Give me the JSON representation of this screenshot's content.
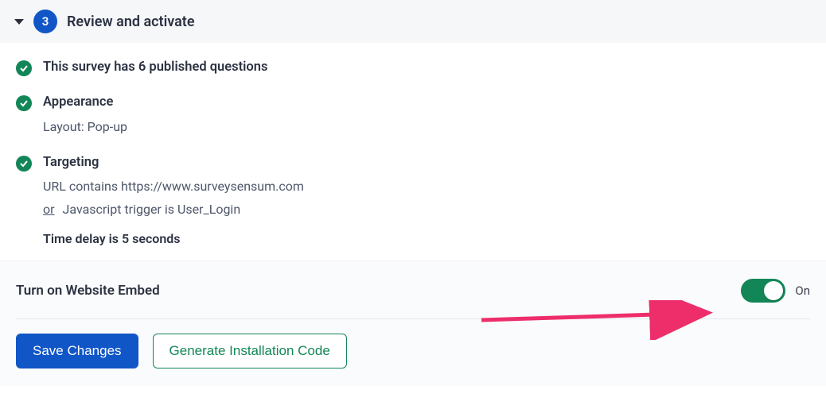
{
  "header": {
    "step_number": "3",
    "title": "Review and activate"
  },
  "review": {
    "questions_line": "This survey has 6 published questions",
    "appearance": {
      "title": "Appearance",
      "layout_line": "Layout: Pop-up"
    },
    "targeting": {
      "title": "Targeting",
      "url_line": "URL contains https://www.surveysensum.com",
      "or_label": "or",
      "js_trigger_line": "Javascript trigger is User_Login",
      "time_delay_line": "Time delay is 5 seconds"
    }
  },
  "embed": {
    "label": "Turn on Website Embed",
    "toggle_on": true,
    "state_text": "On"
  },
  "buttons": {
    "save": "Save Changes",
    "generate_code": "Generate Installation Code"
  },
  "colors": {
    "primary_blue": "#1056c7",
    "success_green": "#138657",
    "annotation_pink": "#ed2e6b"
  }
}
